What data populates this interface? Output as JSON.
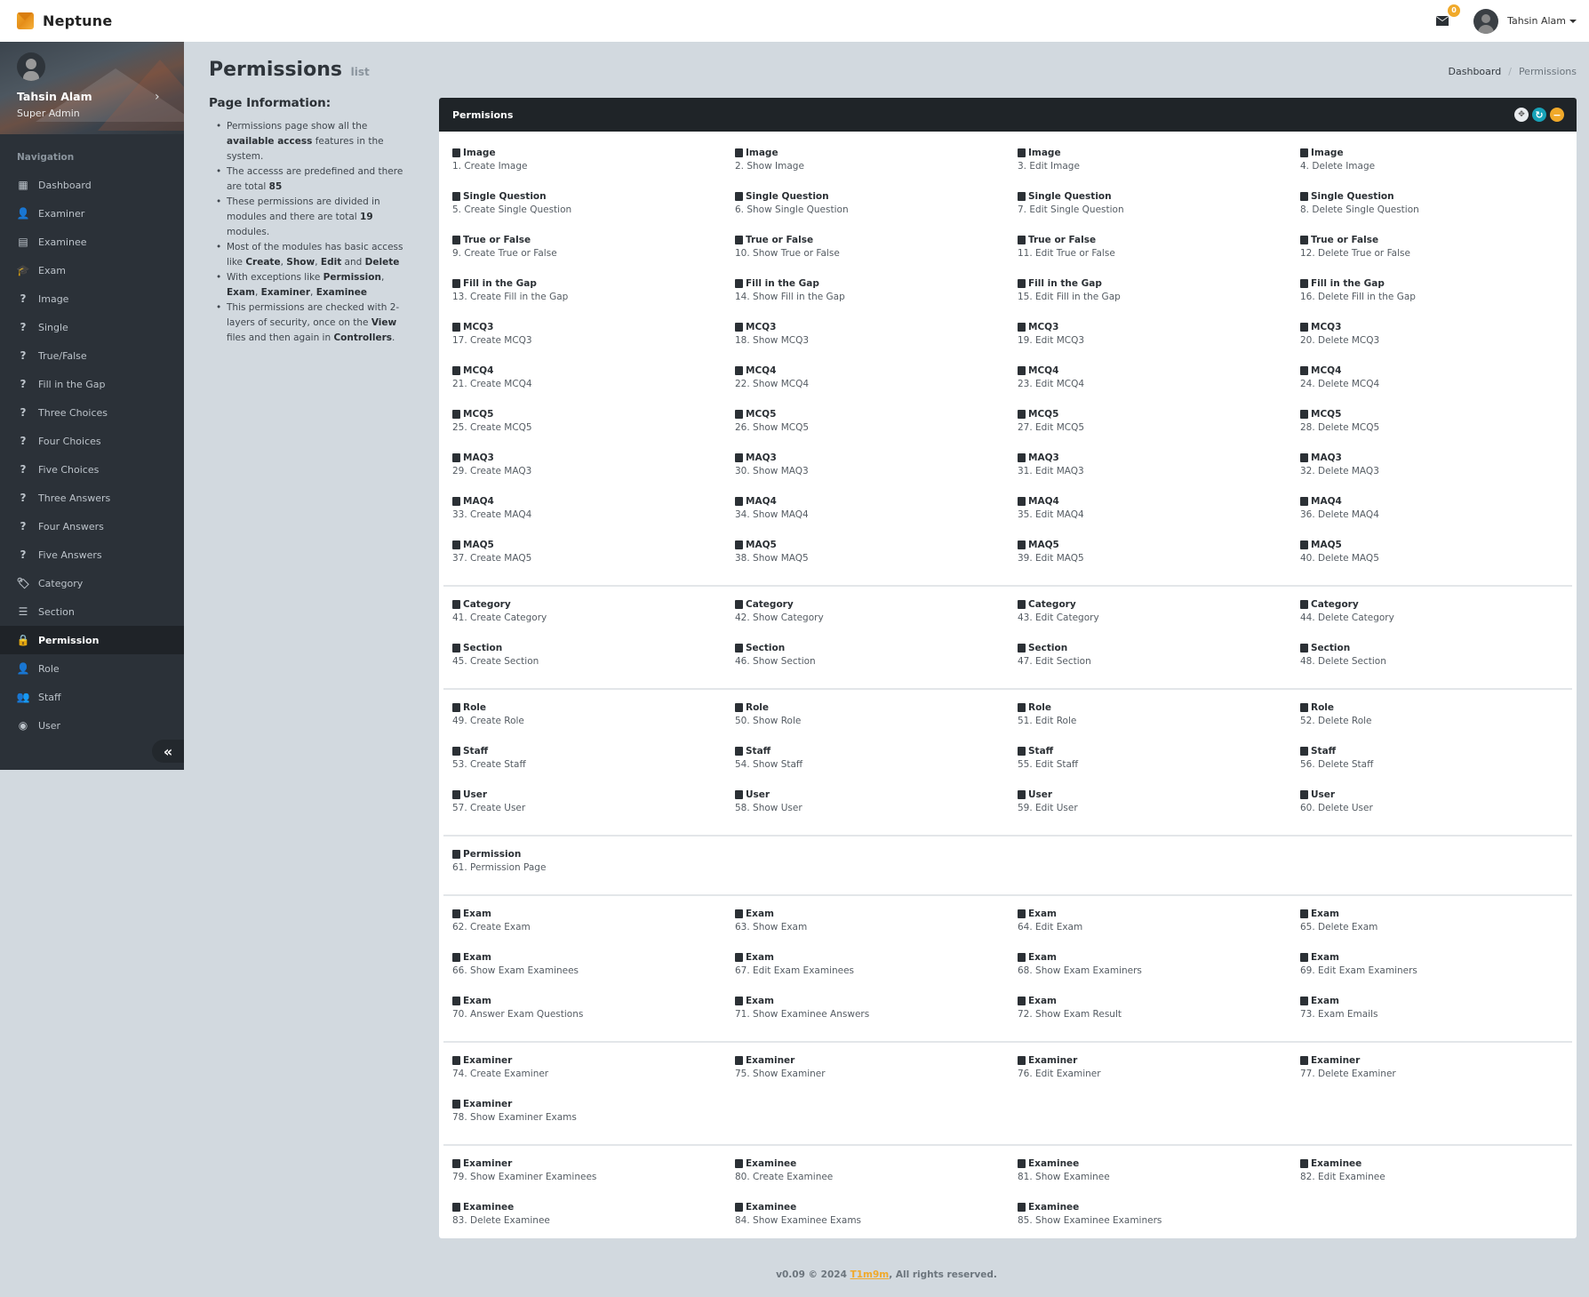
{
  "app": {
    "name": "Neptune"
  },
  "topbar": {
    "mail_count": "0",
    "user_name": "Tahsin Alam"
  },
  "sidebar": {
    "profile": {
      "name": "Tahsin Alam",
      "role": "Super Admin"
    },
    "nav_header": "Navigation",
    "items": [
      {
        "label": "Dashboard",
        "icon": "dashboard-icon",
        "glyph": "▦"
      },
      {
        "label": "Examiner",
        "icon": "user-icon",
        "glyph": "👤"
      },
      {
        "label": "Examinee",
        "icon": "id-card-icon",
        "glyph": "▤"
      },
      {
        "label": "Exam",
        "icon": "graduation-cap-icon",
        "glyph": "🎓"
      },
      {
        "label": "Image",
        "icon": "question-circle-icon",
        "glyph": "?"
      },
      {
        "label": "Single",
        "icon": "question-icon",
        "glyph": "?"
      },
      {
        "label": "True/False",
        "icon": "question-circle-icon",
        "glyph": "?"
      },
      {
        "label": "Fill in the Gap",
        "icon": "question-icon",
        "glyph": "?"
      },
      {
        "label": "Three Choices",
        "icon": "question-circle-icon",
        "glyph": "?"
      },
      {
        "label": "Four Choices",
        "icon": "question-icon",
        "glyph": "?"
      },
      {
        "label": "Five Choices",
        "icon": "question-circle-icon",
        "glyph": "?"
      },
      {
        "label": "Three Answers",
        "icon": "question-icon",
        "glyph": "?"
      },
      {
        "label": "Four Answers",
        "icon": "question-circle-icon",
        "glyph": "?"
      },
      {
        "label": "Five Answers",
        "icon": "question-icon",
        "glyph": "?"
      },
      {
        "label": "Category",
        "icon": "tags-icon",
        "glyph": "🏷"
      },
      {
        "label": "Section",
        "icon": "list-icon",
        "glyph": "☰"
      },
      {
        "label": "Permission",
        "icon": "lock-icon",
        "glyph": "🔒",
        "active": true
      },
      {
        "label": "Role",
        "icon": "user-plus-icon",
        "glyph": "👤"
      },
      {
        "label": "Staff",
        "icon": "users-icon",
        "glyph": "👥"
      },
      {
        "label": "User",
        "icon": "user-circle-icon",
        "glyph": "◉"
      }
    ],
    "collapse_glyph": "«"
  },
  "page": {
    "title": "Permissions",
    "subtitle": "list",
    "breadcrumb": {
      "home": "Dashboard",
      "current": "Permissions"
    }
  },
  "info": {
    "heading": "Page Information:",
    "items": [
      [
        {
          "t": "Permissions page show all the "
        },
        {
          "b": "available access"
        },
        {
          "t": " features in the system."
        }
      ],
      [
        {
          "t": "The accesss are predefined and there are total "
        },
        {
          "b": "85"
        }
      ],
      [
        {
          "t": "These permissions are divided in modules and there are total "
        },
        {
          "b": "19"
        },
        {
          "t": " modules."
        }
      ],
      [
        {
          "t": "Most of the modules has basic access like "
        },
        {
          "b": "Create"
        },
        {
          "t": ", "
        },
        {
          "b": "Show"
        },
        {
          "t": ", "
        },
        {
          "b": "Edit"
        },
        {
          "t": " and "
        },
        {
          "b": "Delete"
        }
      ],
      [
        {
          "t": "With exceptions like "
        },
        {
          "b": "Permission"
        },
        {
          "t": ", "
        },
        {
          "b": "Exam"
        },
        {
          "t": ", "
        },
        {
          "b": "Examiner"
        },
        {
          "t": ", "
        },
        {
          "b": "Examinee"
        }
      ],
      [
        {
          "t": "This permissions are checked with 2-layers of security, once on the "
        },
        {
          "b": "View"
        },
        {
          "t": " files and then again in "
        },
        {
          "b": "Controllers"
        },
        {
          "t": "."
        }
      ]
    ]
  },
  "card": {
    "title": "Permisions",
    "tools": [
      "expand",
      "refresh",
      "minimize"
    ],
    "groups": [
      [
        [
          "Image",
          "1. Create Image"
        ],
        [
          "Image",
          "2. Show Image"
        ],
        [
          "Image",
          "3. Edit Image"
        ],
        [
          "Image",
          "4. Delete Image"
        ],
        [
          "Single Question",
          "5. Create Single Question"
        ],
        [
          "Single Question",
          "6. Show Single Question"
        ],
        [
          "Single Question",
          "7. Edit Single Question"
        ],
        [
          "Single Question",
          "8. Delete Single Question"
        ],
        [
          "True or False",
          "9. Create True or False"
        ],
        [
          "True or False",
          "10. Show True or False"
        ],
        [
          "True or False",
          "11. Edit True or False"
        ],
        [
          "True or False",
          "12. Delete True or False"
        ],
        [
          "Fill in the Gap",
          "13. Create Fill in the Gap"
        ],
        [
          "Fill in the Gap",
          "14. Show Fill in the Gap"
        ],
        [
          "Fill in the Gap",
          "15. Edit Fill in the Gap"
        ],
        [
          "Fill in the Gap",
          "16. Delete Fill in the Gap"
        ],
        [
          "MCQ3",
          "17. Create MCQ3"
        ],
        [
          "MCQ3",
          "18. Show MCQ3"
        ],
        [
          "MCQ3",
          "19. Edit MCQ3"
        ],
        [
          "MCQ3",
          "20. Delete MCQ3"
        ],
        [
          "MCQ4",
          "21. Create MCQ4"
        ],
        [
          "MCQ4",
          "22. Show MCQ4"
        ],
        [
          "MCQ4",
          "23. Edit MCQ4"
        ],
        [
          "MCQ4",
          "24. Delete MCQ4"
        ],
        [
          "MCQ5",
          "25. Create MCQ5"
        ],
        [
          "MCQ5",
          "26. Show MCQ5"
        ],
        [
          "MCQ5",
          "27. Edit MCQ5"
        ],
        [
          "MCQ5",
          "28. Delete MCQ5"
        ],
        [
          "MAQ3",
          "29. Create MAQ3"
        ],
        [
          "MAQ3",
          "30. Show MAQ3"
        ],
        [
          "MAQ3",
          "31. Edit MAQ3"
        ],
        [
          "MAQ3",
          "32. Delete MAQ3"
        ],
        [
          "MAQ4",
          "33. Create MAQ4"
        ],
        [
          "MAQ4",
          "34. Show MAQ4"
        ],
        [
          "MAQ4",
          "35. Edit MAQ4"
        ],
        [
          "MAQ4",
          "36. Delete MAQ4"
        ],
        [
          "MAQ5",
          "37. Create MAQ5"
        ],
        [
          "MAQ5",
          "38. Show MAQ5"
        ],
        [
          "MAQ5",
          "39. Edit MAQ5"
        ],
        [
          "MAQ5",
          "40. Delete MAQ5"
        ]
      ],
      [
        [
          "Category",
          "41. Create Category"
        ],
        [
          "Category",
          "42. Show Category"
        ],
        [
          "Category",
          "43. Edit Category"
        ],
        [
          "Category",
          "44. Delete Category"
        ],
        [
          "Section",
          "45. Create Section"
        ],
        [
          "Section",
          "46. Show Section"
        ],
        [
          "Section",
          "47. Edit Section"
        ],
        [
          "Section",
          "48. Delete Section"
        ]
      ],
      [
        [
          "Role",
          "49. Create Role"
        ],
        [
          "Role",
          "50. Show Role"
        ],
        [
          "Role",
          "51. Edit Role"
        ],
        [
          "Role",
          "52. Delete Role"
        ],
        [
          "Staff",
          "53. Create Staff"
        ],
        [
          "Staff",
          "54. Show Staff"
        ],
        [
          "Staff",
          "55. Edit Staff"
        ],
        [
          "Staff",
          "56. Delete Staff"
        ],
        [
          "User",
          "57. Create User"
        ],
        [
          "User",
          "58. Show User"
        ],
        [
          "User",
          "59. Edit User"
        ],
        [
          "User",
          "60. Delete User"
        ]
      ],
      [
        [
          "Permission",
          "61. Permission Page"
        ]
      ],
      [
        [
          "Exam",
          "62. Create Exam"
        ],
        [
          "Exam",
          "63. Show Exam"
        ],
        [
          "Exam",
          "64. Edit Exam"
        ],
        [
          "Exam",
          "65. Delete Exam"
        ],
        [
          "Exam",
          "66. Show Exam Examinees"
        ],
        [
          "Exam",
          "67. Edit Exam Examinees"
        ],
        [
          "Exam",
          "68. Show Exam Examiners"
        ],
        [
          "Exam",
          "69. Edit Exam Examiners"
        ],
        [
          "Exam",
          "70. Answer Exam Questions"
        ],
        [
          "Exam",
          "71. Show Examinee Answers"
        ],
        [
          "Exam",
          "72. Show Exam Result"
        ],
        [
          "Exam",
          "73. Exam Emails"
        ]
      ],
      [
        [
          "Examiner",
          "74. Create Examiner"
        ],
        [
          "Examiner",
          "75. Show Examiner"
        ],
        [
          "Examiner",
          "76. Edit Examiner"
        ],
        [
          "Examiner",
          "77. Delete Examiner"
        ],
        [
          "Examiner",
          "78. Show Examiner Exams"
        ]
      ],
      [
        [
          "Examiner",
          "79. Show Examiner Examinees"
        ],
        [
          "Examinee",
          "80. Create Examinee"
        ],
        [
          "Examinee",
          "81. Show Examinee"
        ],
        [
          "Examinee",
          "82. Edit Examinee"
        ],
        [
          "Examinee",
          "83. Delete Examinee"
        ],
        [
          "Examinee",
          "84. Show Examinee Exams"
        ],
        [
          "Examinee",
          "85. Show Examinee Examiners"
        ]
      ]
    ]
  },
  "footer": {
    "prefix": "v0.09 © 2024 ",
    "link": "T1m9m",
    "suffix": ", All rights reserved."
  },
  "colors": {
    "accent": "#f0a92a",
    "sidebar_bg": "#2b3138",
    "header_dark": "#1f2428",
    "page_bg": "#d2d9df",
    "info_teal": "#17a2b8"
  }
}
